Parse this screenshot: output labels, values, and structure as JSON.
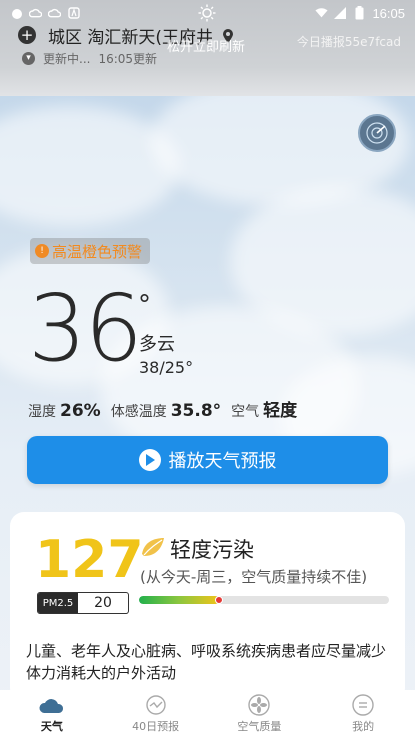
{
  "status_bar": {
    "time": "16:05"
  },
  "header": {
    "location": "城区 淘汇新天(王府井",
    "refresh_tip": "松开立即刷新",
    "broadcast": "今日播报55e7fcad",
    "update_status": "更新中...",
    "update_time": "16:05更新"
  },
  "weather": {
    "warning": "高温橙色预警",
    "temperature": "36",
    "degree_symbol": "°",
    "condition": "多云",
    "range": "38/25°",
    "metrics": [
      {
        "label": "湿度",
        "value": "26%"
      },
      {
        "label": "体感温度",
        "value": "35.8°"
      },
      {
        "label": "空气",
        "value": "轻度"
      }
    ],
    "play_label": "播放天气预报"
  },
  "air": {
    "aqi": "127",
    "pm_label": "PM2.5",
    "pm_value": "20",
    "level": "轻度污染",
    "description": "(从今天-周三，空气质量持续不佳)",
    "bar_fraction": 0.32,
    "advice": "儿童、老年人及心脏病、呼吸系统疾病患者应尽量减少体力消耗大的户外活动"
  },
  "nav": [
    {
      "label": "天气",
      "icon": "weather-icon",
      "active": true
    },
    {
      "label": "40日预报",
      "icon": "forecast-icon",
      "active": false
    },
    {
      "label": "空气质量",
      "icon": "fan-icon",
      "active": false
    },
    {
      "label": "我的",
      "icon": "profile-icon",
      "active": false
    }
  ],
  "colors": {
    "accent": "#1e8ee8",
    "warning": "#f28a1f",
    "aqi": "#f0c419"
  }
}
